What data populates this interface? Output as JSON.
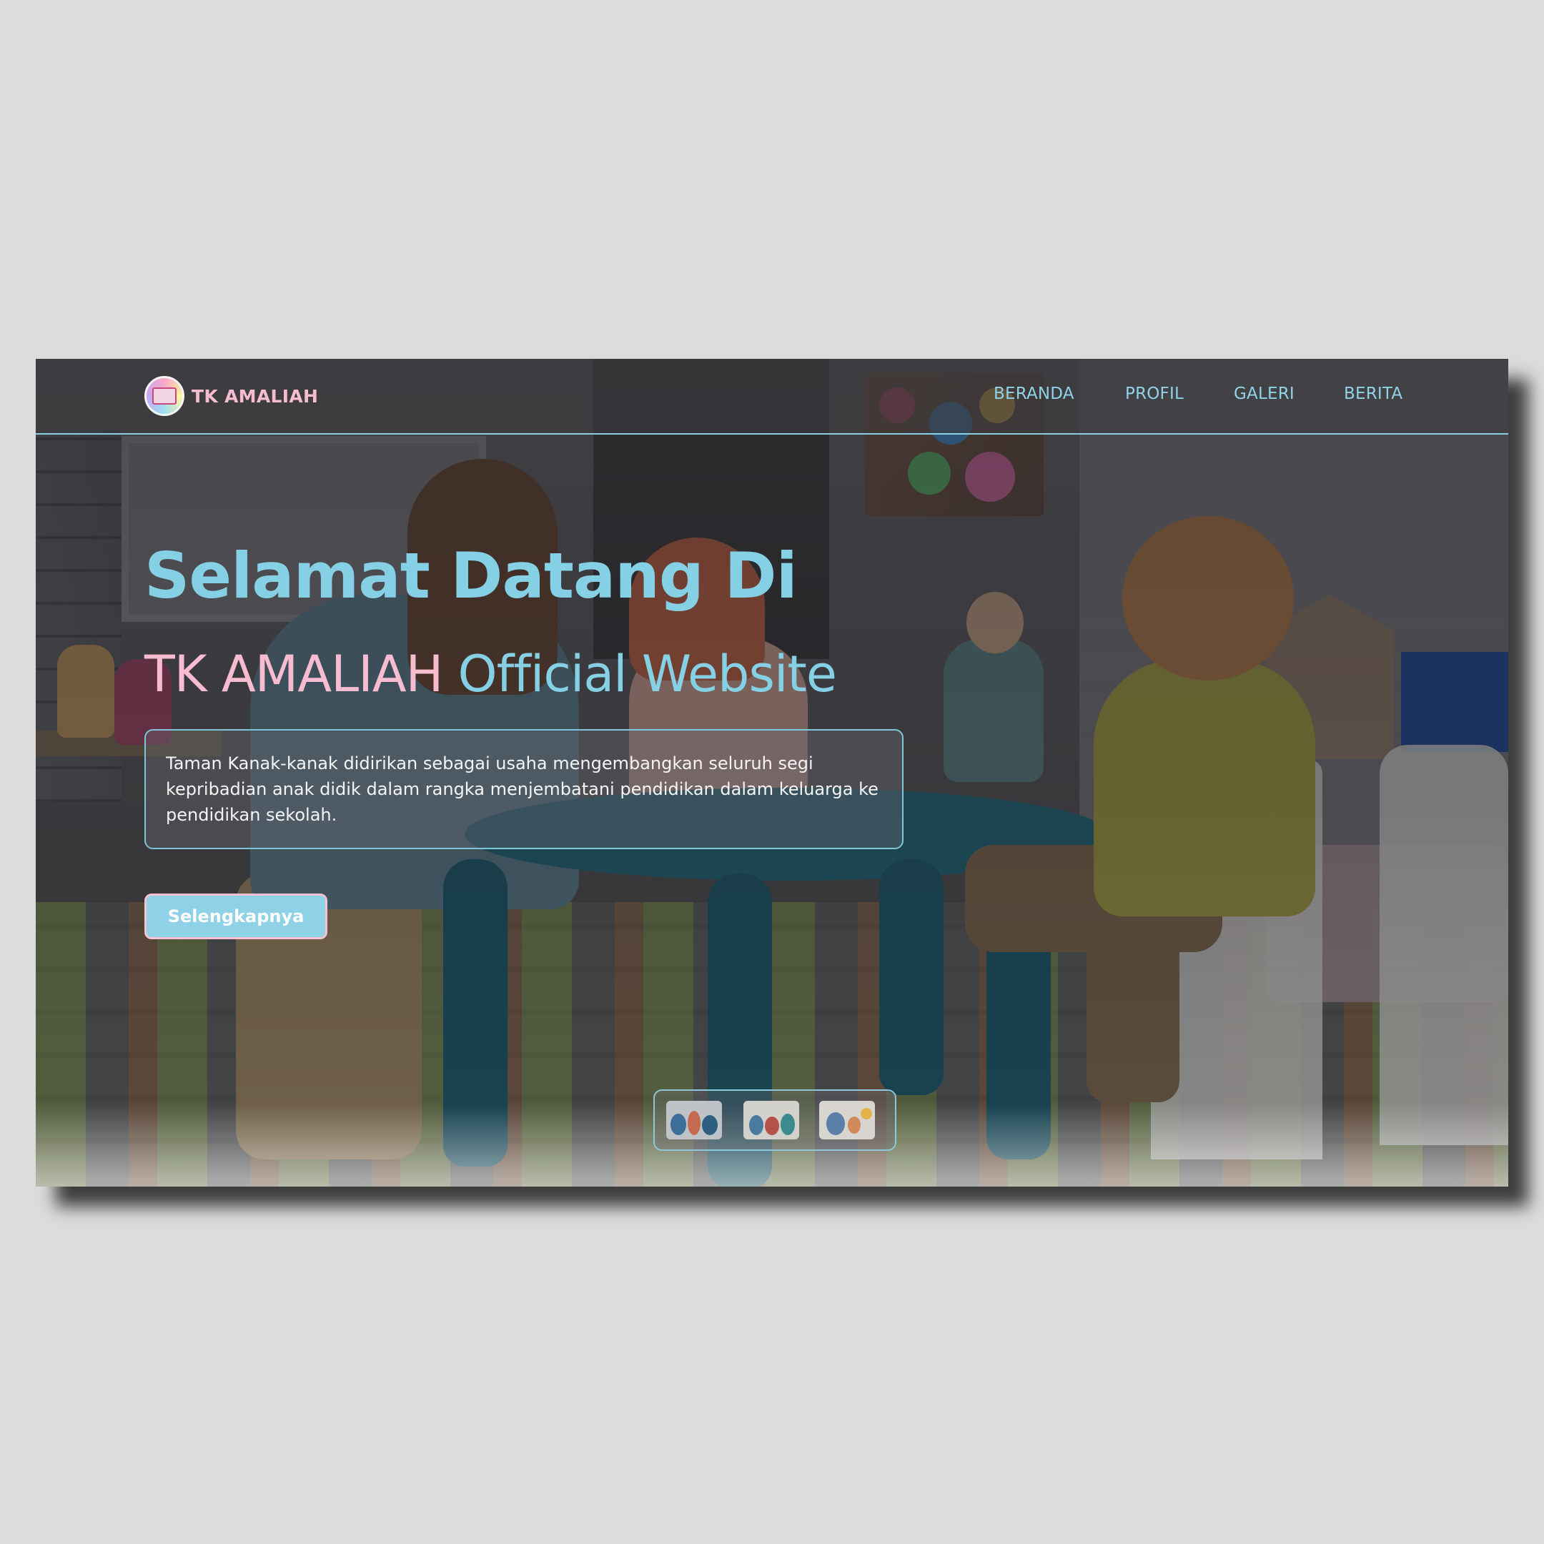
{
  "brand": {
    "name": "TK AMALIAH",
    "logo_icon": "school-logo-icon"
  },
  "nav": {
    "items": [
      {
        "label": "BERANDA"
      },
      {
        "label": "PROFIL"
      },
      {
        "label": "GALERI"
      },
      {
        "label": "BERITA"
      }
    ]
  },
  "hero": {
    "line1": "Selamat Datang Di",
    "line2_brand": "TK AMALIAH",
    "line2_rest": " Official Website",
    "description": "Taman Kanak-kanak didirikan sebagai usaha mengembangkan seluruh segi kepribadian anak didik dalam rangka menjembatani pendidikan dalam keluarga ke pendidikan sekolah.",
    "cta_label": "Selengkapnya"
  },
  "thumbnails": {
    "count": 3
  },
  "colors": {
    "accent_blue": "#86d0e6",
    "accent_pink": "#f7bcd0",
    "page_bg": "#dcdcdc"
  }
}
